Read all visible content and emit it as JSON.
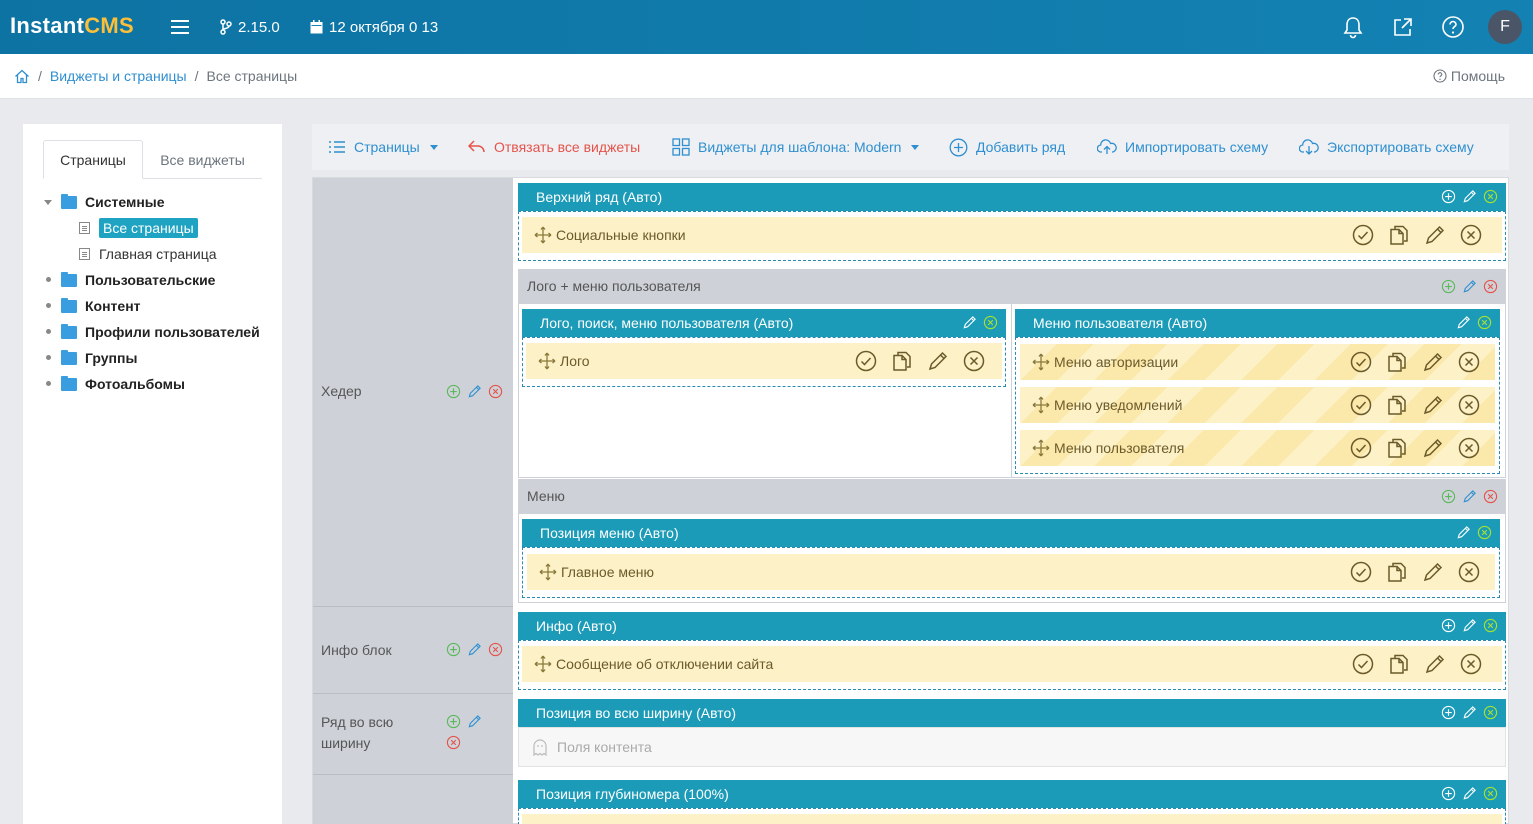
{
  "topbar": {
    "logo_main": "Instant",
    "logo_cms": "CMS",
    "version": "2.15.0",
    "date": "12 октября 0 13",
    "avatar_letter": "F",
    "colors": {
      "bar": "#0f79a8",
      "logo_accent": "#fbbf3a"
    }
  },
  "breadcrumbs": {
    "item1": "Виджеты и страницы",
    "item2": "Все страницы",
    "help": "Помощь"
  },
  "sidebar": {
    "tab_pages": "Страницы",
    "tab_widgets": "Все виджеты",
    "tree": [
      {
        "label": "Системные",
        "children": [
          "Все страницы",
          "Главная страница"
        ]
      },
      {
        "label": "Пользовательские"
      },
      {
        "label": "Контент"
      },
      {
        "label": "Профили пользователей"
      },
      {
        "label": "Группы"
      },
      {
        "label": "Фотоальбомы"
      }
    ]
  },
  "toolbar": {
    "pages": "Страницы",
    "unbind": "Отвязать все виджеты",
    "template_widgets": "Виджеты для шаблона: Modern",
    "add_row": "Добавить ряд",
    "import": "Импортировать схему",
    "export": "Экспортировать схему"
  },
  "rows": {
    "header": {
      "label": "Хедер",
      "top_row": {
        "title": "Верхний ряд (Авто)",
        "widgets": [
          "Социальные кнопки"
        ]
      },
      "logo_row": {
        "title": "Лого + меню пользователя",
        "left": {
          "title": "Лого, поиск, меню пользователя (Авто)",
          "widgets": [
            "Лого"
          ]
        },
        "right": {
          "title": "Меню пользователя (Авто)",
          "widgets": [
            "Меню авторизации",
            "Меню уведомлений",
            "Меню пользователя"
          ]
        }
      },
      "menu_row": {
        "title": "Меню",
        "position": {
          "title": "Позиция меню (Авто)",
          "widgets": [
            "Главное меню"
          ]
        }
      }
    },
    "info": {
      "label": "Инфо блок",
      "position": "Инфо (Авто)",
      "widgets": [
        "Сообщение об отключении сайта"
      ]
    },
    "fullwidth": {
      "label": "Ряд во всю ширину",
      "position": "Позиция во всю ширину (Авто)",
      "empty": "Поля контента"
    },
    "depth": {
      "position": "Позиция глубиномера (100%)"
    }
  }
}
